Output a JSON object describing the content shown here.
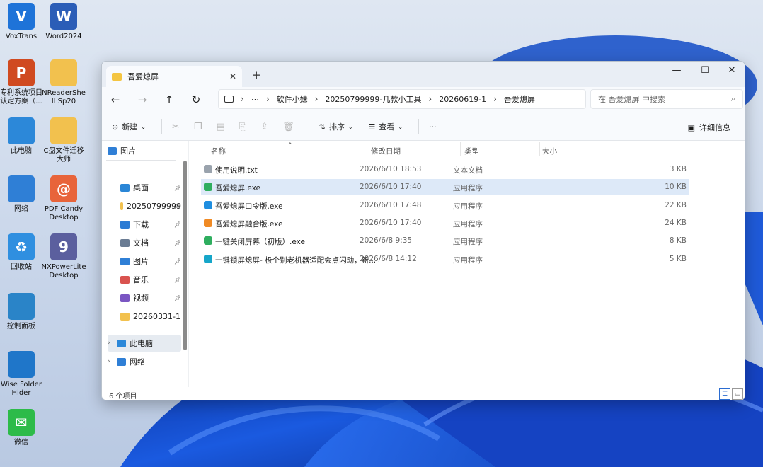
{
  "desktop": {
    "icons": [
      {
        "label": "VoxTrans",
        "glyph": "V",
        "color": "#1e73d8",
        "icon": "voxtrans-icon"
      },
      {
        "label": "Word2024",
        "glyph": "W",
        "color": "#2b5db7",
        "icon": "word-icon"
      },
      {
        "label": "专利系统项目认定方案（...",
        "glyph": "P",
        "color": "#d04a20",
        "icon": "ppt-icon"
      },
      {
        "label": "NReaderShell Sp20",
        "glyph": "",
        "color": "#f2c14e",
        "icon": "folder-icon"
      },
      {
        "label": "此电脑",
        "glyph": "",
        "color": "#2c88d9",
        "icon": "computer-icon"
      },
      {
        "label": "C盘文件迁移大师",
        "glyph": "",
        "color": "#f2c14e",
        "icon": "folder-icon"
      },
      {
        "label": "网络",
        "glyph": "",
        "color": "#2f7fd6",
        "icon": "network-icon"
      },
      {
        "label": "PDF Candy Desktop",
        "glyph": "@",
        "color": "#e8643a",
        "icon": "pdf-candy-icon"
      },
      {
        "label": "回收站",
        "glyph": "♻",
        "color": "#2f8fe0",
        "icon": "recycle-bin-icon"
      },
      {
        "label": "NXPowerLite Desktop",
        "glyph": "9",
        "color": "#5b5f9e",
        "icon": "nxpowerlite-icon"
      },
      {
        "label": "控制面板",
        "glyph": "",
        "color": "#2a84c8",
        "icon": "control-panel-icon"
      },
      {
        "label": "Wise Folder Hider",
        "glyph": "",
        "color": "#1f76c9",
        "icon": "wise-folder-hider-icon"
      },
      {
        "label": "微信",
        "glyph": "✉",
        "color": "#2dbb49",
        "icon": "wechat-icon"
      }
    ]
  },
  "window": {
    "tab_title": "吾爱熄屏",
    "new_tab": "+",
    "minimize": "—",
    "maximize": "☐",
    "close": "✕",
    "nav": {
      "back": "←",
      "forward": "→",
      "up": "↑",
      "refresh": "↻"
    },
    "breadcrumb": [
      "软件小妹",
      "20250799999-几款小工具",
      "20260619-1",
      "吾爱熄屏"
    ],
    "breadcrumb_more": "⋯",
    "search_placeholder": "在 吾爱熄屏 中搜索",
    "toolbar": {
      "new": "新建",
      "sort": "排序",
      "view": "查看",
      "more": "···",
      "details": "详细信息"
    },
    "nav_pane": {
      "top": {
        "label": "图片",
        "color": "#2f7fd6"
      },
      "pinned": [
        {
          "label": "桌面",
          "color": "#2a86d6",
          "pinned": true
        },
        {
          "label": "20250799999",
          "color": "#f2c14e",
          "pinned": true
        },
        {
          "label": "下载",
          "color": "#2b7bd4",
          "pinned": true,
          "glyph": "↓"
        },
        {
          "label": "文档",
          "color": "#6a7c93",
          "pinned": true
        },
        {
          "label": "图片",
          "color": "#2f7fd6",
          "pinned": true
        },
        {
          "label": "音乐",
          "color": "#d9534f",
          "pinned": true
        },
        {
          "label": "视频",
          "color": "#7a56c2",
          "pinned": true
        },
        {
          "label": "20260331-1",
          "color": "#f2c14e",
          "pinned": false
        }
      ],
      "tree": [
        {
          "label": "此电脑",
          "color": "#2c88d9"
        },
        {
          "label": "网络",
          "color": "#2f7fd6"
        }
      ]
    },
    "columns": {
      "name": "名称",
      "modified": "修改日期",
      "type": "类型",
      "size": "大小"
    },
    "files": [
      {
        "name": "使用说明.txt",
        "modified": "2026/6/10 18:53",
        "type": "文本文档",
        "size": "3 KB",
        "color": "#9aa3ad",
        "selected": false
      },
      {
        "name": "吾爱熄屏.exe",
        "modified": "2026/6/10 17:40",
        "type": "应用程序",
        "size": "10 KB",
        "color": "#2fae5f",
        "selected": true
      },
      {
        "name": "吾爱熄屏口令版.exe",
        "modified": "2026/6/10 17:48",
        "type": "应用程序",
        "size": "22 KB",
        "color": "#1f8ee0",
        "selected": false
      },
      {
        "name": "吾爱熄屏融合版.exe",
        "modified": "2026/6/10 17:40",
        "type": "应用程序",
        "size": "24 KB",
        "color": "#f08a24",
        "selected": false
      },
      {
        "name": "一键关闭屏幕（初版）.exe",
        "modified": "2026/6/8 9:35",
        "type": "应用程序",
        "size": "8 KB",
        "color": "#2fae5f",
        "selected": false
      },
      {
        "name": "一键锁屏熄屏- 极个别老机器适配会点闪动，新...",
        "modified": "2026/6/8 14:12",
        "type": "应用程序",
        "size": "5 KB",
        "color": "#16a6c9",
        "selected": false
      }
    ],
    "status": {
      "count": "6 个项目"
    }
  }
}
